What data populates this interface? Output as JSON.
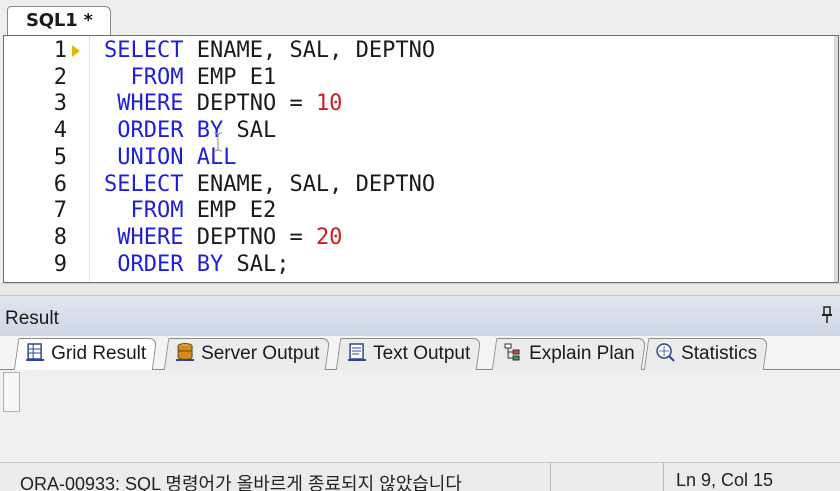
{
  "editor_tab": {
    "label": "SQL1 *"
  },
  "editor": {
    "lines": [
      {
        "num": "1",
        "indent": "",
        "tokens": [
          [
            "kw",
            "SELECT"
          ],
          [
            "t",
            " ENAME, SAL, DEPTNO"
          ]
        ]
      },
      {
        "num": "2",
        "indent": "  ",
        "tokens": [
          [
            "kw",
            "FROM"
          ],
          [
            "t",
            " EMP E1"
          ]
        ]
      },
      {
        "num": "3",
        "indent": " ",
        "tokens": [
          [
            "kw",
            "WHERE"
          ],
          [
            "t",
            " DEPTNO = "
          ],
          [
            "num",
            "10"
          ]
        ]
      },
      {
        "num": "4",
        "indent": " ",
        "tokens": [
          [
            "kw",
            "ORDER BY"
          ],
          [
            "t",
            " SAL"
          ]
        ]
      },
      {
        "num": "5",
        "indent": " ",
        "tokens": [
          [
            "kw",
            "UNION ALL"
          ]
        ]
      },
      {
        "num": "6",
        "indent": "",
        "tokens": [
          [
            "kw",
            "SELECT"
          ],
          [
            "t",
            " ENAME, SAL, DEPTNO"
          ]
        ]
      },
      {
        "num": "7",
        "indent": "  ",
        "tokens": [
          [
            "kw",
            "FROM"
          ],
          [
            "t",
            " EMP E2"
          ]
        ]
      },
      {
        "num": "8",
        "indent": " ",
        "tokens": [
          [
            "kw",
            "WHERE"
          ],
          [
            "t",
            " DEPTNO = "
          ],
          [
            "num",
            "20"
          ]
        ]
      },
      {
        "num": "9",
        "indent": " ",
        "tokens": [
          [
            "kw",
            "ORDER BY"
          ],
          [
            "t",
            " SAL;"
          ]
        ]
      }
    ],
    "current_line": "1"
  },
  "result_panel": {
    "title": "Result",
    "tabs": [
      {
        "label": "Grid Result",
        "icon": "grid-icon",
        "active": true
      },
      {
        "label": "Server Output",
        "icon": "database-icon",
        "active": false
      },
      {
        "label": "Text Output",
        "icon": "text-output-icon",
        "active": false
      },
      {
        "label": "Explain Plan",
        "icon": "explain-plan-icon",
        "active": false
      },
      {
        "label": "Statistics",
        "icon": "statistics-icon",
        "active": false
      }
    ]
  },
  "status_bar": {
    "message": "ORA-00933: SQL 명령어가 올바르게 종료되지 않았습니다",
    "position": "Ln 9, Col 15"
  },
  "colors": {
    "keyword": "#1e1eda",
    "number": "#cc1e1e",
    "arrow": "#e6b800"
  }
}
